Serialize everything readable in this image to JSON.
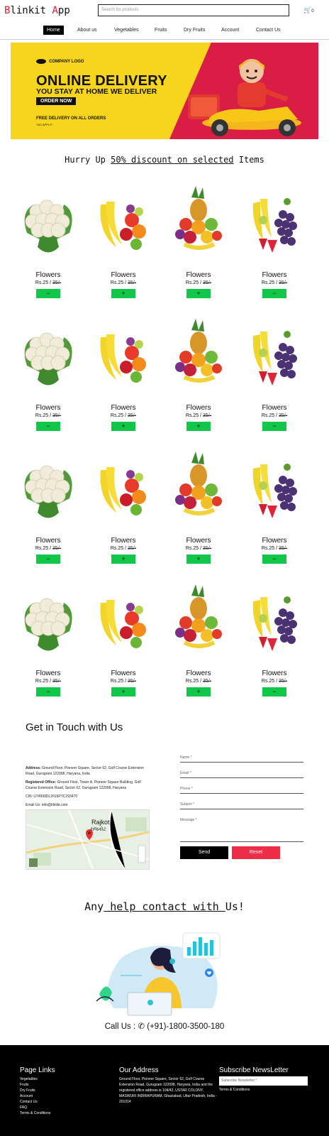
{
  "header": {
    "logo_b": "B",
    "logo_mid": "linkit ",
    "logo_a": "A",
    "logo_end": "pp",
    "search_placeholder": "Search for products",
    "cart_count": "0"
  },
  "nav": {
    "items": [
      "Home",
      "About us",
      "Vegetables",
      "Fruits",
      "Dry Fruits",
      "Account",
      "Contact Us"
    ]
  },
  "banner": {
    "company": "COMPANY LOGO",
    "title": "ONLINE DELIVERY",
    "subtitle": "YOU STAY AT HOME WE DELIVER",
    "button": "ORDER NOW",
    "free": "FREE DELIVERY ON ALL ORDERS",
    "terms": "T&C APPLY*"
  },
  "promo": {
    "pre": "Hurry Up ",
    "underlined": "50% discount on selected",
    "post": " Items"
  },
  "product": {
    "name": "Flowers",
    "price": "Rs.25 / ",
    "old_price": "35/-",
    "btn_minus": "−",
    "btn_plus": "+"
  },
  "product_images": [
    "cauliflower",
    "banana-fruit-mix",
    "fruit-basket",
    "grapes-banana-strawberry"
  ],
  "contact": {
    "title": "Get in Touch with Us",
    "address_label": "Address:",
    "address": "Ground Floor, Pioneer Square, Sector 62, Golf Course Extension Road, Gurugram 122098, Haryana, India",
    "registered_label": "Registered Office:",
    "registered": "Ground Floor, Tower A, Pioneer Square Building, Golf Course Extension Road, Sector 62, Gurugram 122098, Haryana",
    "cin": "CIN: U74999DL2016PTC293470",
    "email": "Email Us: info@blinkit.com",
    "map_city": "Rajkot",
    "map_city_local": "રાજકોટ",
    "fields": [
      "Name *",
      "Email *",
      "Phone *",
      "Subject *",
      "Message *"
    ],
    "send": "Send",
    "reset": "Reset"
  },
  "help": {
    "pre": "Any",
    "underlined": " help contact with ",
    "post": "Us!"
  },
  "call": {
    "label": "Call Us : ",
    "phone": " (+91)-1800-3500-180"
  },
  "footer": {
    "links_title": "Page Links",
    "links": [
      "Vegetables",
      "Fruits",
      "Dry Fruits",
      "Account",
      "Contact Us",
      "FAQ",
      "Terms & Conditions"
    ],
    "address_title": "Our Address",
    "address": "Ground Floor, Pioneer Square, Sector 62, Golf Course Extension Road, Gurugram 122098, Haryana, India and the registered office address is 104/42, USTAR COLONY, MASWURI INDIRAPURAM, Ghaziabad, Uttar Pradesh, India - 201014",
    "newsletter_title": "Subscribe NewsLetter",
    "newsletter_placeholder": "Subscribe Newsletter *",
    "newsletter_terms": "Terms & Conditions"
  },
  "colors": {
    "accent_red": "#e0202e",
    "button_green": "#12c64a",
    "banner_yellow": "#f7d51d",
    "banner_red": "#d91d45",
    "reset_red": "#ee2d48"
  }
}
